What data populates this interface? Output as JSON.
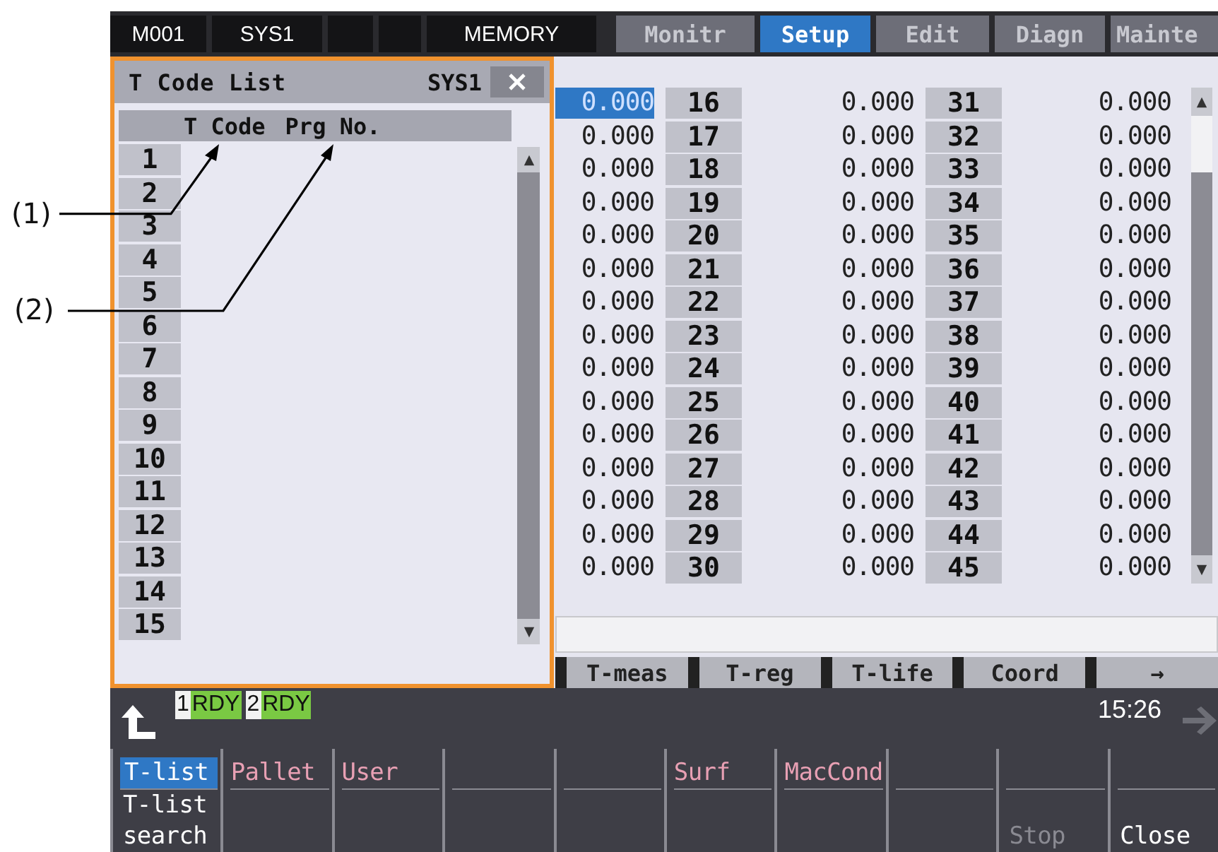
{
  "header": {
    "status_cells": [
      {
        "text": "M001"
      },
      {
        "text": "SYS1"
      },
      {},
      {},
      {
        "text": "MEMORY"
      }
    ],
    "tabs": [
      {
        "label": "Monitr",
        "selected": false
      },
      {
        "label": "Setup",
        "selected": true
      },
      {
        "label": "Edit",
        "selected": false
      },
      {
        "label": "Diagn",
        "selected": false
      },
      {
        "label": "Mainte",
        "selected": false
      }
    ]
  },
  "popup": {
    "title": "T Code List",
    "system": "SYS1",
    "columns": [
      "T Code",
      "Prg No."
    ],
    "rows": [
      "1",
      "2",
      "3",
      "4",
      "5",
      "6",
      "7",
      "8",
      "9",
      "10",
      "11",
      "12",
      "13",
      "14",
      "15"
    ]
  },
  "table": {
    "rows": [
      {
        "values": [
          {
            "text": "0.000",
            "selected": true
          },
          {
            "text": "0.000",
            "selected": false
          },
          {
            "text": "0.000",
            "selected": false
          }
        ],
        "numbers": [
          "16",
          "31"
        ]
      },
      {
        "values": [
          {
            "text": "0.000",
            "selected": false
          },
          {
            "text": "0.000",
            "selected": false
          },
          {
            "text": "0.000",
            "selected": false
          }
        ],
        "numbers": [
          "17",
          "32"
        ]
      },
      {
        "values": [
          {
            "text": "0.000",
            "selected": false
          },
          {
            "text": "0.000",
            "selected": false
          },
          {
            "text": "0.000",
            "selected": false
          }
        ],
        "numbers": [
          "18",
          "33"
        ]
      },
      {
        "values": [
          {
            "text": "0.000",
            "selected": false
          },
          {
            "text": "0.000",
            "selected": false
          },
          {
            "text": "0.000",
            "selected": false
          }
        ],
        "numbers": [
          "19",
          "34"
        ]
      },
      {
        "values": [
          {
            "text": "0.000",
            "selected": false
          },
          {
            "text": "0.000",
            "selected": false
          },
          {
            "text": "0.000",
            "selected": false
          }
        ],
        "numbers": [
          "20",
          "35"
        ]
      },
      {
        "values": [
          {
            "text": "0.000",
            "selected": false
          },
          {
            "text": "0.000",
            "selected": false
          },
          {
            "text": "0.000",
            "selected": false
          }
        ],
        "numbers": [
          "21",
          "36"
        ]
      },
      {
        "values": [
          {
            "text": "0.000",
            "selected": false
          },
          {
            "text": "0.000",
            "selected": false
          },
          {
            "text": "0.000",
            "selected": false
          }
        ],
        "numbers": [
          "22",
          "37"
        ]
      },
      {
        "values": [
          {
            "text": "0.000",
            "selected": false
          },
          {
            "text": "0.000",
            "selected": false
          },
          {
            "text": "0.000",
            "selected": false
          }
        ],
        "numbers": [
          "23",
          "38"
        ]
      },
      {
        "values": [
          {
            "text": "0.000",
            "selected": false
          },
          {
            "text": "0.000",
            "selected": false
          },
          {
            "text": "0.000",
            "selected": false
          }
        ],
        "numbers": [
          "24",
          "39"
        ]
      },
      {
        "values": [
          {
            "text": "0.000",
            "selected": false
          },
          {
            "text": "0.000",
            "selected": false
          },
          {
            "text": "0.000",
            "selected": false
          }
        ],
        "numbers": [
          "25",
          "40"
        ]
      },
      {
        "values": [
          {
            "text": "0.000",
            "selected": false
          },
          {
            "text": "0.000",
            "selected": false
          },
          {
            "text": "0.000",
            "selected": false
          }
        ],
        "numbers": [
          "26",
          "41"
        ]
      },
      {
        "values": [
          {
            "text": "0.000",
            "selected": false
          },
          {
            "text": "0.000",
            "selected": false
          },
          {
            "text": "0.000",
            "selected": false
          }
        ],
        "numbers": [
          "27",
          "42"
        ]
      },
      {
        "values": [
          {
            "text": "0.000",
            "selected": false
          },
          {
            "text": "0.000",
            "selected": false
          },
          {
            "text": "0.000",
            "selected": false
          }
        ],
        "numbers": [
          "28",
          "43"
        ]
      },
      {
        "values": [
          {
            "text": "0.000",
            "selected": false
          },
          {
            "text": "0.000",
            "selected": false
          },
          {
            "text": "0.000",
            "selected": false
          }
        ],
        "numbers": [
          "29",
          "44"
        ]
      },
      {
        "values": [
          {
            "text": "0.000",
            "selected": false
          },
          {
            "text": "0.000",
            "selected": false
          },
          {
            "text": "0.000",
            "selected": false
          }
        ],
        "numbers": [
          "30",
          "45"
        ]
      }
    ]
  },
  "function_tabs": [
    "T-meas",
    "T-reg",
    "T-life",
    "Coord",
    "→"
  ],
  "status": {
    "systems": [
      {
        "number": "1",
        "status": "RDY"
      },
      {
        "number": "2",
        "status": "RDY"
      }
    ],
    "time": "15:26"
  },
  "menu_keys": [
    {
      "upper": {
        "label": "T-list",
        "selected": true
      },
      "lower": {
        "label": "T-list search",
        "disabled": false
      }
    },
    {
      "upper": {
        "label": "Pallet",
        "selected": false
      }
    },
    {
      "upper": {
        "label": "User",
        "selected": false
      }
    },
    {
      "blank": true
    },
    {
      "blank": true
    },
    {
      "upper": {
        "label": "Surf",
        "selected": false
      }
    },
    {
      "upper": {
        "label": "MacCond",
        "selected": false
      }
    },
    {
      "blank": true
    },
    {
      "lower": {
        "label": "Stop",
        "disabled": true
      }
    },
    {
      "lower": {
        "label": "Close",
        "disabled": false
      }
    }
  ],
  "callouts": [
    "(1)",
    "(2)"
  ]
}
